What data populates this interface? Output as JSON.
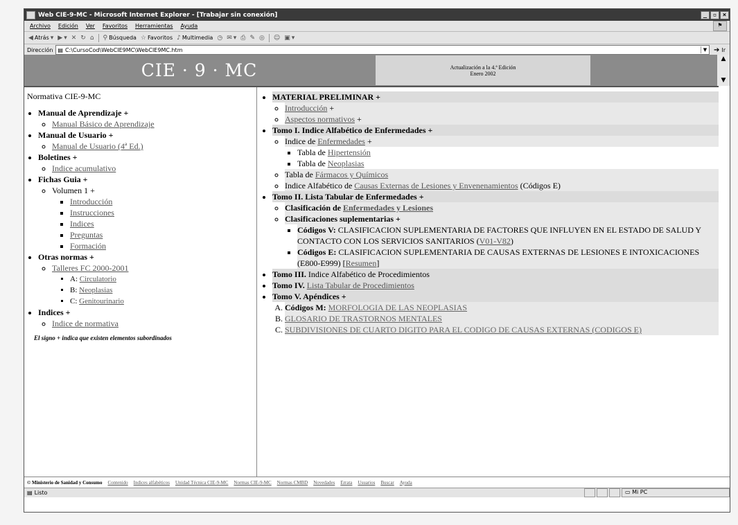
{
  "window": {
    "title": "Web CIE-9-MC - Microsoft Internet Explorer - [Trabajar sin conexión]"
  },
  "menu": [
    "Archivo",
    "Edición",
    "Ver",
    "Favoritos",
    "Herramientas",
    "Ayuda"
  ],
  "toolbar": {
    "back": "Atrás",
    "search": "Búsqueda",
    "favorites": "Favoritos",
    "media": "Multimedia"
  },
  "address": {
    "label": "Dirección",
    "value": "C:\\CursoCod\\WebCIE9MC\\WebCIE9MC.htm",
    "go": "Ir"
  },
  "banner": {
    "title": "CIE · 9 · MC",
    "info1": "Actualización a la 4.ª Edición",
    "info2": "Enero 2002"
  },
  "left": {
    "title": "Normativa CIE-9-MC",
    "manual_aprendizaje": "Manual de Aprendizaje +",
    "manual_basico": "Manual Básico de Aprendizaje",
    "manual_usuario": "Manual de Usuario +",
    "manual_usuario_ed": "Manual de Usuario (4ª Ed.)",
    "boletines": "Boletines +",
    "indice_acumulativo": "Indice acumulativo",
    "fichas": "Fichas Guia +",
    "volumen": "Volumen 1 +",
    "vol_items": [
      "Introducción",
      "Instrucciones",
      "Indices",
      "Preguntas",
      "Formación"
    ],
    "otras": "Otras normas +",
    "talleres": "Talleres FC 2000-2001",
    "t_a": "A:",
    "t_a_link": "Circulatorio",
    "t_b": "B:",
    "t_b_link": "Neoplasias",
    "t_c": "C:",
    "t_c_link": "Genitourinario",
    "indices": "Indices +",
    "indice_normativa": "Indice de normativa",
    "note": "El signo + indica que existen elementos subordinados"
  },
  "right": {
    "material": "MATERIAL PRELIMINAR +",
    "introduccion": "Introducción",
    "plus": "+",
    "aspectos": "Aspectos normativos",
    "tomo1": "Tomo I. Indice Alfabético de Enfermedades +",
    "indice_de": "Indice de",
    "enfermedades": "Enfermedades",
    "tabla_de": "Tabla de",
    "hipertension": "Hipertensión",
    "neoplasias": "Neoplasias",
    "farmacos": "Fármacos y Químicos",
    "indice_alf": "Indice Alfabético de",
    "causas": "Causas Externas de Lesiones y Envenenamientos",
    "codigos_e": "(Códigos E)",
    "tomo2": "Tomo II. Lista Tabular de Enfermedades +",
    "clasif": "Clasificación de",
    "enf_les": "Enfermedades y Lesiones",
    "clasif_supl": "Clasificaciones suplementarias +",
    "cod_v": "Códigos V:",
    "cod_v_text": "CLASIFICACION SUPLEMENTARIA DE FACTORES QUE INFLUYEN EN EL ESTADO DE SALUD Y CONTACTO CON LOS SERVICIOS SANITARIOS (",
    "cod_v_link": "V01-V82",
    "cod_v_end": ")",
    "cod_e": "Códigos E:",
    "cod_e_text": "CLASIFICACION SUPLEMENTARIA DE CAUSAS EXTERNAS DE LESIONES E INTOXICACIONES (E800-E999) [",
    "resumen": "Resumen",
    "cod_e_end": "]",
    "tomo3_b": "Tomo III.",
    "tomo3": "Indice Alfabético de Procedimientos",
    "tomo4_b": "Tomo IV.",
    "tomo4": "Lista Tabular de Procedimientos",
    "tomo5": "Tomo V. Apéndices +",
    "cod_m": "Códigos M:",
    "morfologia": "MORFOLOGIA DE LAS NEOPLASIAS",
    "glosario": "GLOSARIO DE TRASTORNOS MENTALES",
    "subdiv": "SUBDIVISIONES DE CUARTO DIGITO PARA EL CODIGO DE CAUSAS EXTERNAS (CODIGOS E)"
  },
  "footer": {
    "ministerio": "© Ministerio de Sanidad y Consumo",
    "links": [
      "Contenido",
      "Indices alfabéticos",
      "Unidad Técnica CIE-9-MC",
      "Normas CIE-9-MC",
      "Normas CMBD",
      "Novedades",
      "Errata",
      "Usuarios",
      "Buscar",
      "Ayuda"
    ]
  },
  "status": {
    "text": "Listo",
    "zone": "Mi PC"
  }
}
